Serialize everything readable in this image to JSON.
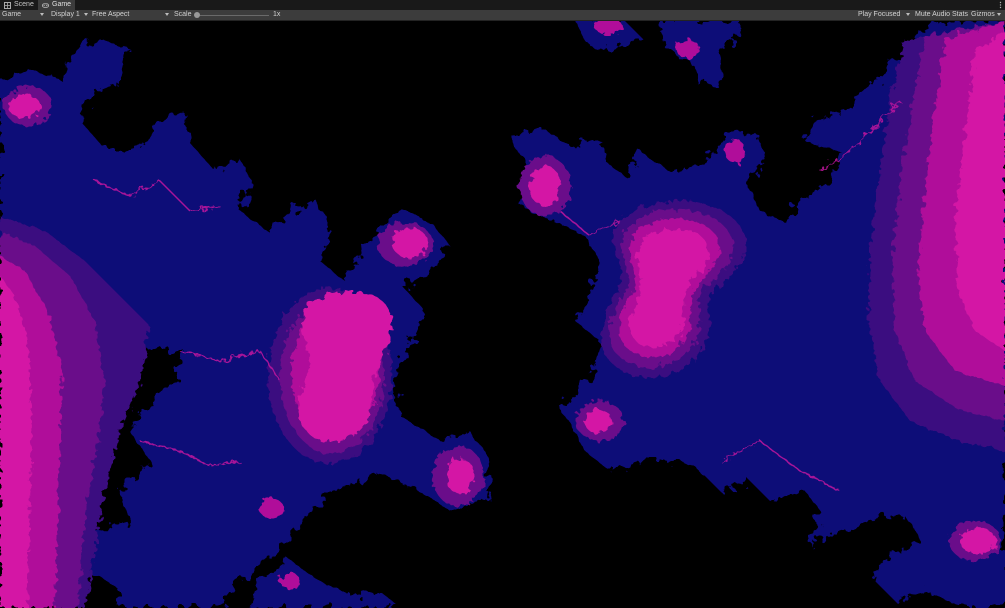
{
  "tabs": [
    {
      "label": "Scene",
      "icon": "scene-icon",
      "active": false
    },
    {
      "label": "Game",
      "icon": "game-controller-icon",
      "active": true
    }
  ],
  "toolbar": {
    "view_select": "Game",
    "display_select": "Display 1",
    "aspect_select": "Free Aspect",
    "scale_label": "Scale",
    "scale_value": "1x",
    "scale_level": 0.0,
    "play_mode_select": "Play Focused",
    "mute_audio": "Mute Audio",
    "stats": "Stats",
    "gizmos": "Gizmos"
  },
  "colors": {
    "background": "#000000",
    "navy": "#0e0b78",
    "deep_purple": "#3a0b80",
    "purple": "#6a0d8a",
    "magenta": "#b0119a",
    "pink": "#d418a5",
    "editor_bar": "#3c3c3c",
    "tab_bar": "#191919"
  }
}
